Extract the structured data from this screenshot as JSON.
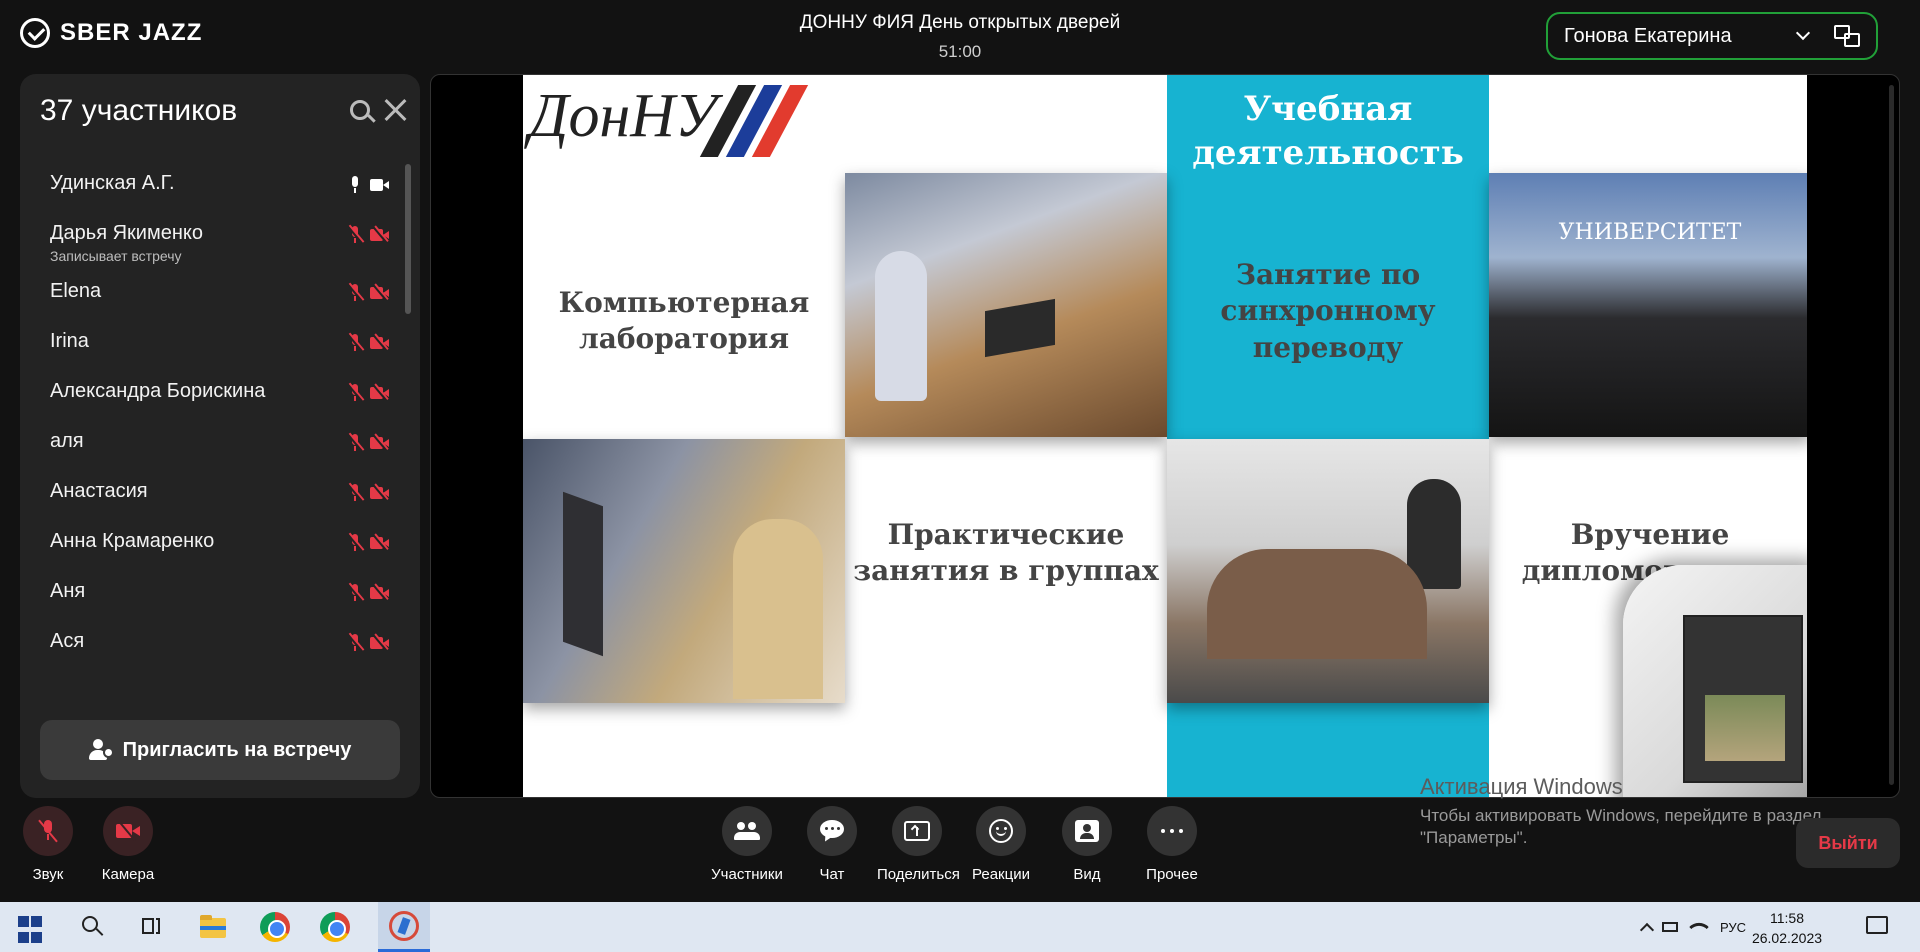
{
  "app": {
    "brand": "SBER JAZZ",
    "meeting_title": "ДОННУ ФИЯ День открытых дверей",
    "timer": "51:00",
    "user_name": "Гонова Екатерина"
  },
  "sidebar": {
    "title": "37 участников",
    "invite_label": "Пригласить на встречу",
    "participants": [
      {
        "name": "Удинская А.Г.",
        "sub": "",
        "mic": "on",
        "cam": "on"
      },
      {
        "name": "Дарья Якименко",
        "sub": "Записывает встречу",
        "mic": "muted",
        "cam": "off"
      },
      {
        "name": "Elena",
        "sub": "",
        "mic": "muted",
        "cam": "off"
      },
      {
        "name": "Irina",
        "sub": "",
        "mic": "muted",
        "cam": "off"
      },
      {
        "name": "Александра Борискина",
        "sub": "",
        "mic": "muted",
        "cam": "off"
      },
      {
        "name": "аля",
        "sub": "",
        "mic": "muted",
        "cam": "off"
      },
      {
        "name": "Анастасия",
        "sub": "",
        "mic": "muted",
        "cam": "off"
      },
      {
        "name": "Анна Крамаренко",
        "sub": "",
        "mic": "muted",
        "cam": "off"
      },
      {
        "name": "Аня",
        "sub": "",
        "mic": "muted",
        "cam": "off"
      },
      {
        "name": "Ася",
        "sub": "",
        "mic": "muted",
        "cam": "off"
      }
    ]
  },
  "slide": {
    "brand": "ДонНУ",
    "heading": "Учебная деятельность",
    "photo_banner": "УНИВЕРСИТЕТ",
    "cells": {
      "computer_lab": "Компьютерная лаборатория",
      "sync_translation": "Занятие по синхронному переводу",
      "practical": "Практические занятия в группах",
      "diplomas": "Вручение дипломов выпу"
    }
  },
  "controls": {
    "sound": "Звук",
    "camera": "Камера",
    "participants": "Участники",
    "chat": "Чат",
    "share": "Поделиться",
    "reactions": "Реакции",
    "view": "Вид",
    "more": "Прочее",
    "exit": "Выйти"
  },
  "windows_activation": {
    "title": "Активация Windows",
    "line1": "Чтобы активировать Windows, перейдите в раздел",
    "line2": "\"Параметры\"."
  },
  "taskbar": {
    "lang": "РУС",
    "time": "11:58",
    "date": "26.02.2023"
  },
  "colors": {
    "accent_green": "#21a038",
    "muted_red": "#e53947",
    "slide_teal": "#17b3d1"
  }
}
